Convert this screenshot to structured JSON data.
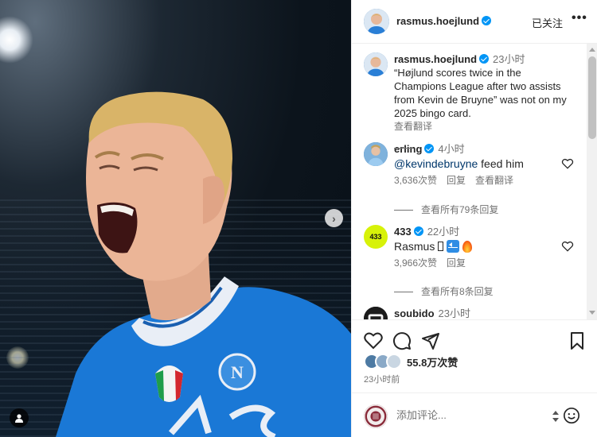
{
  "header": {
    "username": "rasmus.hoejlund",
    "follow_label": "已关注",
    "more_label": "•••"
  },
  "caption": {
    "username": "rasmus.hoejlund",
    "time": "23小时",
    "text": "“Højlund scores twice in the Champions League after two assists from Kevin de Bruyne” was not on my 2025 bingo card.",
    "translate": "查看翻译"
  },
  "comments": [
    {
      "username": "erling",
      "time": "4小时",
      "mention": "@kevindebruyne",
      "text": " feed him",
      "likes": "3,636次赞",
      "reply": "回复",
      "translate": "查看翻译",
      "view_replies": "查看所有79条回复"
    },
    {
      "username": "433",
      "avatar_label": "433",
      "time": "22小时",
      "text": "Rasmus ",
      "likes": "3,966次赞",
      "reply": "回复",
      "view_replies": "查看所有8条回复"
    },
    {
      "username": "soubido",
      "time": "23小时"
    }
  ],
  "actions": {
    "likes_count": "55.8万次赞",
    "post_time": "23小时前"
  },
  "add_comment": {
    "placeholder": "添加评论..."
  },
  "colors": {
    "verified": "#0095f6",
    "jersey": "#1a78d6",
    "avatar_433": "#d7f209"
  },
  "icons": [
    "heart-icon",
    "comment-icon",
    "share-icon",
    "bookmark-icon",
    "emoji-icon",
    "chevron-right-icon",
    "user-tag-icon",
    "verified-icon"
  ]
}
